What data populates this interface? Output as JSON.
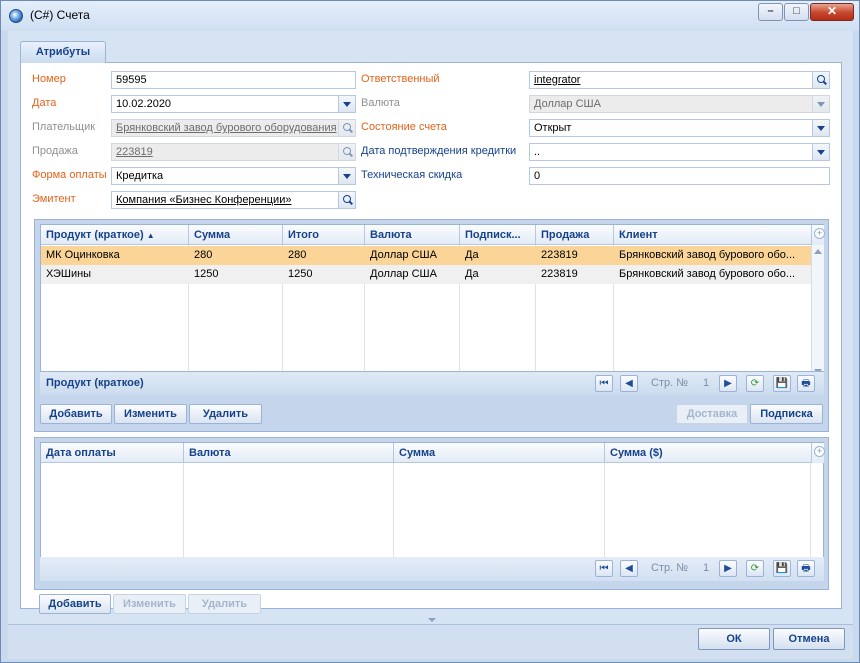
{
  "window": {
    "title": "(C#) Счета"
  },
  "tabs": [
    {
      "label": "Атрибуты"
    }
  ],
  "form": {
    "number": {
      "label": "Номер",
      "value": "59595"
    },
    "date": {
      "label": "Дата",
      "value": "10.02.2020"
    },
    "payer": {
      "label": "Плательщик",
      "value": "Брянковский завод бурового оборудования"
    },
    "sale": {
      "label": "Продажа",
      "value": "223819"
    },
    "payment_form": {
      "label": "Форма оплаты",
      "value": "Кредитка"
    },
    "issuer": {
      "label": "Эмитент",
      "value": "Компания «Бизнес Конференции»"
    },
    "responsible": {
      "label": "Ответственный",
      "value": "integrator"
    },
    "currency": {
      "label": "Валюта",
      "value": "Доллар США"
    },
    "account_state": {
      "label": "Состояние счета",
      "value": "Открыт"
    },
    "credit_confirm_date": {
      "label": "Дата подтверждения кредитки",
      "value": ".."
    },
    "tech_discount": {
      "label": "Техническая скидка",
      "value": "0"
    }
  },
  "products_grid": {
    "columns": [
      "Продукт (краткое)",
      "Сумма",
      "Итого",
      "Валюта",
      "Подписк...",
      "Продажа",
      "Клиент"
    ],
    "sort_indicator": "▲",
    "rows": [
      [
        "МК Оцинковка",
        "280",
        "280",
        "Доллар США",
        "Да",
        "223819",
        "Брянковский завод бурового обо..."
      ],
      [
        "ХЭШины",
        "1250",
        "1250",
        "Доллар США",
        "Да",
        "223819",
        "Брянковский завод бурового обо..."
      ]
    ],
    "group_caption": "Продукт (краткое)",
    "pager": {
      "page_label": "Стр. №",
      "page": "1"
    },
    "buttons": {
      "add": "Добавить",
      "edit": "Изменить",
      "delete": "Удалить",
      "delivery": "Доставка",
      "subscription": "Подписка"
    }
  },
  "payments_grid": {
    "columns": [
      "Дата оплаты",
      "Валюта",
      "Сумма",
      "Сумма ($)"
    ],
    "pager": {
      "page_label": "Стр. №",
      "page": "1"
    },
    "buttons": {
      "add": "Добавить",
      "edit": "Изменить",
      "delete": "Удалить"
    }
  },
  "footer": {
    "ok": "ОК",
    "cancel": "Отмена"
  },
  "icons": {
    "first_page": "⏮",
    "prev_page": "◀",
    "next_page": "▶",
    "refresh": "⟳",
    "save": "💾",
    "print": "🖶"
  }
}
